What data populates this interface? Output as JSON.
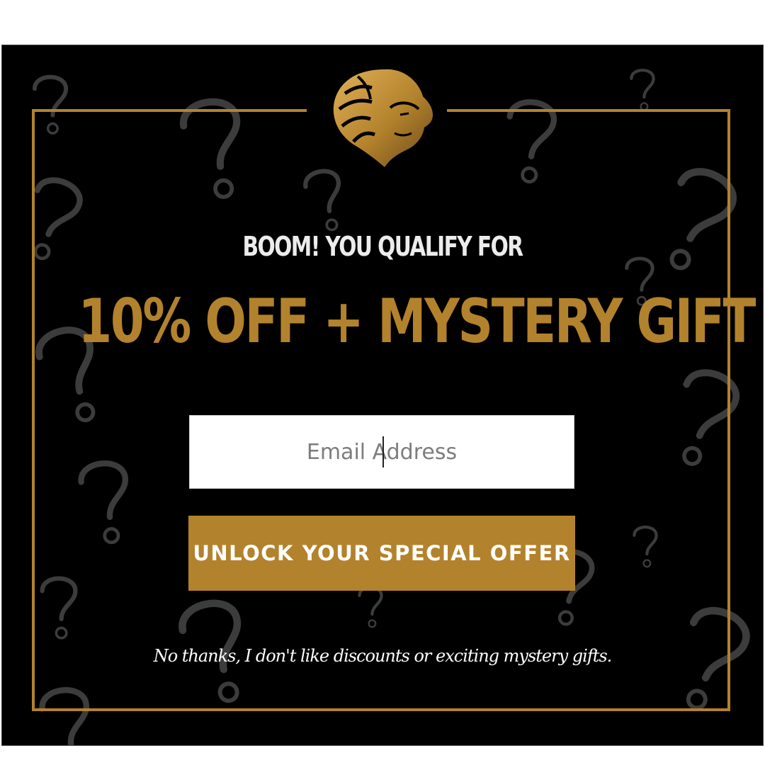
{
  "popup": {
    "pre_headline": "BOOM! YOU QUALIFY FOR",
    "headline": "10% OFF + MYSTERY GIFT",
    "email": {
      "placeholder": "Email Address",
      "value": ""
    },
    "submit_label": "UNLOCK YOUR SPECIAL OFFER",
    "decline_label": "No thanks, I don't like discounts or exciting mystery gifts.",
    "logo_icon": "lion-head-logo",
    "pattern_icon": "question-mark-icon"
  },
  "colors": {
    "background": "#000000",
    "accent_gold": "#b3822c",
    "text_light": "#ececec",
    "input_background": "#ffffff"
  }
}
